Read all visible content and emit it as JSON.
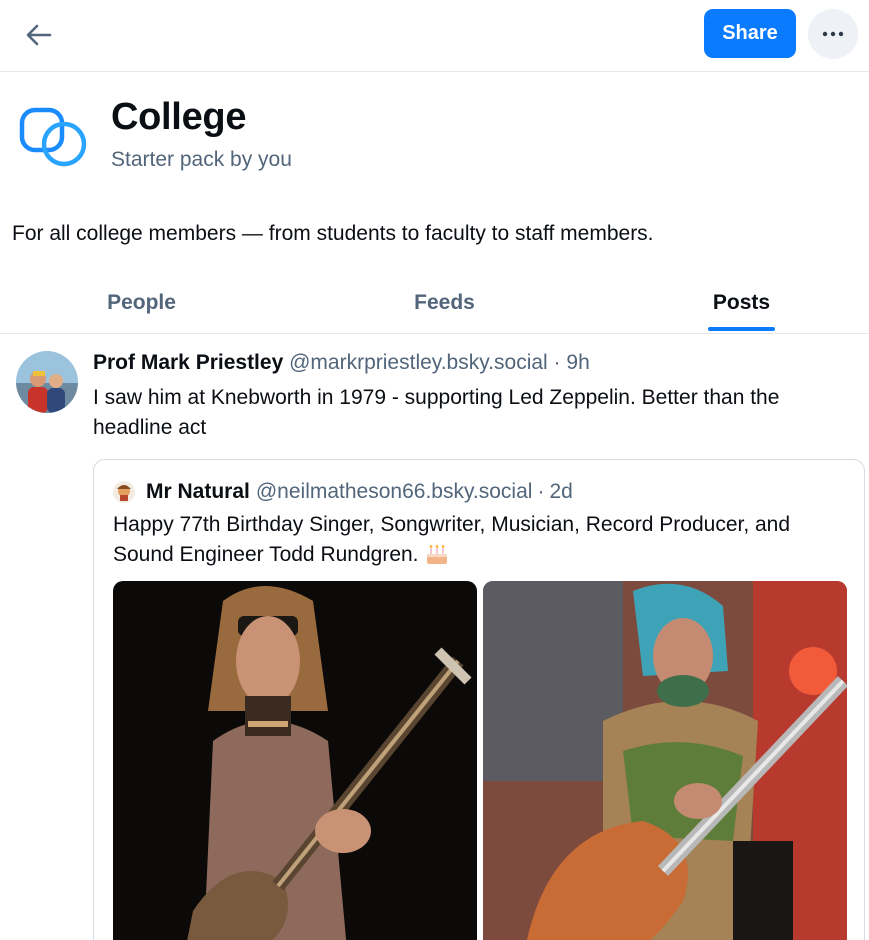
{
  "header": {
    "back_icon": "arrow-left-icon",
    "share_label": "Share",
    "more_icon": "ellipsis-icon",
    "accent_color": "#0a7aff"
  },
  "pack": {
    "logo_icon": "starter-pack-icon",
    "title": "College",
    "subtitle": "Starter pack by you",
    "description": "For all college members — from students to faculty to staff members."
  },
  "tabs": [
    {
      "label": "People",
      "active": false
    },
    {
      "label": "Feeds",
      "active": false
    },
    {
      "label": "Posts",
      "active": true
    }
  ],
  "post": {
    "author": "Prof Mark Priestley",
    "handle": "@markrpriestley.bsky.social",
    "separator": "·",
    "time": "9h",
    "text": "I saw him at Knebworth in 1979 - supporting Led Zeppelin. Better than the headline act",
    "quote": {
      "author": "Mr Natural",
      "handle": "@neilmatheson66.bsky.social",
      "separator": "·",
      "time": "2d",
      "text": "Happy 77th Birthday Singer, Songwriter, Musician, Record Producer, and Sound Engineer Todd Rundgren.",
      "emoji_icon": "birthday-cake-icon"
    }
  }
}
